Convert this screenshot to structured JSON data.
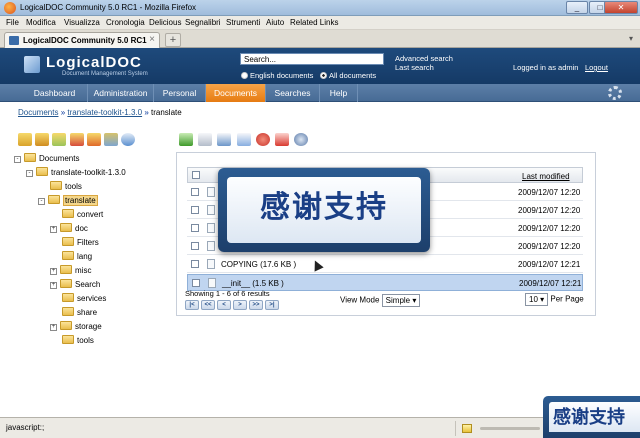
{
  "window": {
    "title": "LogicalDOC Community 5.0 RC1 - Mozilla Firefox",
    "min": "_",
    "max": "□",
    "close": "✕"
  },
  "menubar": [
    "File",
    "Modifica",
    "Visualizza",
    "Cronologia",
    "Delicious",
    "Segnalibri",
    "Strumenti",
    "Aiuto",
    "Related Links"
  ],
  "browser_tab": {
    "label": "LogicalDOC Community 5.0 RC1",
    "close": "×",
    "new_tab": "+",
    "scroll": "▾"
  },
  "header": {
    "logo": "LogicalDOC",
    "logo_sub": "Document Management System",
    "search_value": "Search...",
    "radio_english": "English documents",
    "radio_all": "All documents",
    "advanced_search": "Advanced search",
    "last_search": "Last search",
    "logged_in": "Logged in as admin",
    "logout": "Logout"
  },
  "nav": [
    "Dashboard",
    "Administration",
    "Personal",
    "Documents",
    "Searches",
    "Help"
  ],
  "nav_active": "Documents",
  "breadcrumb": {
    "root": "Documents",
    "parent": "translate-toolkit-1.3.0",
    "current": "translate",
    "sep": "»"
  },
  "tree": [
    {
      "label": "Documents",
      "exp": "-",
      "level": 0
    },
    {
      "label": "translate-toolkit-1.3.0",
      "exp": "-",
      "level": 1
    },
    {
      "label": "tools",
      "exp": "",
      "level": 2
    },
    {
      "label": "translate",
      "exp": "-",
      "level": 2,
      "selected": true
    },
    {
      "label": "convert",
      "exp": "",
      "level": 3
    },
    {
      "label": "doc",
      "exp": "+",
      "level": 3
    },
    {
      "label": "Filters",
      "exp": "",
      "level": 3
    },
    {
      "label": "lang",
      "exp": "",
      "level": 3
    },
    {
      "label": "misc",
      "exp": "+",
      "level": 3
    },
    {
      "label": "Search",
      "exp": "+",
      "level": 3
    },
    {
      "label": "services",
      "exp": "",
      "level": 3
    },
    {
      "label": "share",
      "exp": "",
      "level": 3
    },
    {
      "label": "storage",
      "exp": "+",
      "level": 3
    },
    {
      "label": "tools",
      "exp": "",
      "level": 3
    }
  ],
  "grid": {
    "header_date": "Last modified",
    "rows": [
      {
        "name": "",
        "date": "2009/12/07 12:20"
      },
      {
        "name": "",
        "date": "2009/12/07 12:20"
      },
      {
        "name": "",
        "date": "2009/12/07 12:20"
      },
      {
        "name": "",
        "date": "2009/12/07 12:20"
      },
      {
        "name": "COPYING  (17.6 KB )",
        "date": "2009/12/07 12:21"
      },
      {
        "name": "__init__  (1.5 KB )",
        "date": "2009/12/07 12:21",
        "selected": true
      }
    ]
  },
  "pager": {
    "showing": "Showing 1 - 6 of 6 results",
    "buttons": [
      "|<",
      "<<",
      "<",
      ">",
      ">>",
      ">|"
    ]
  },
  "view_mode": {
    "label": "View Mode",
    "value": "Simple"
  },
  "per_page": {
    "value": "10",
    "label": "Per Page"
  },
  "overlay_text": "感谢支持",
  "status": "javascript:;",
  "colors": {
    "header": "#1e4a7c",
    "nav": "#5d7fa8",
    "active_tab": "#f08a1c",
    "selected_row": "#c0d5f0"
  }
}
